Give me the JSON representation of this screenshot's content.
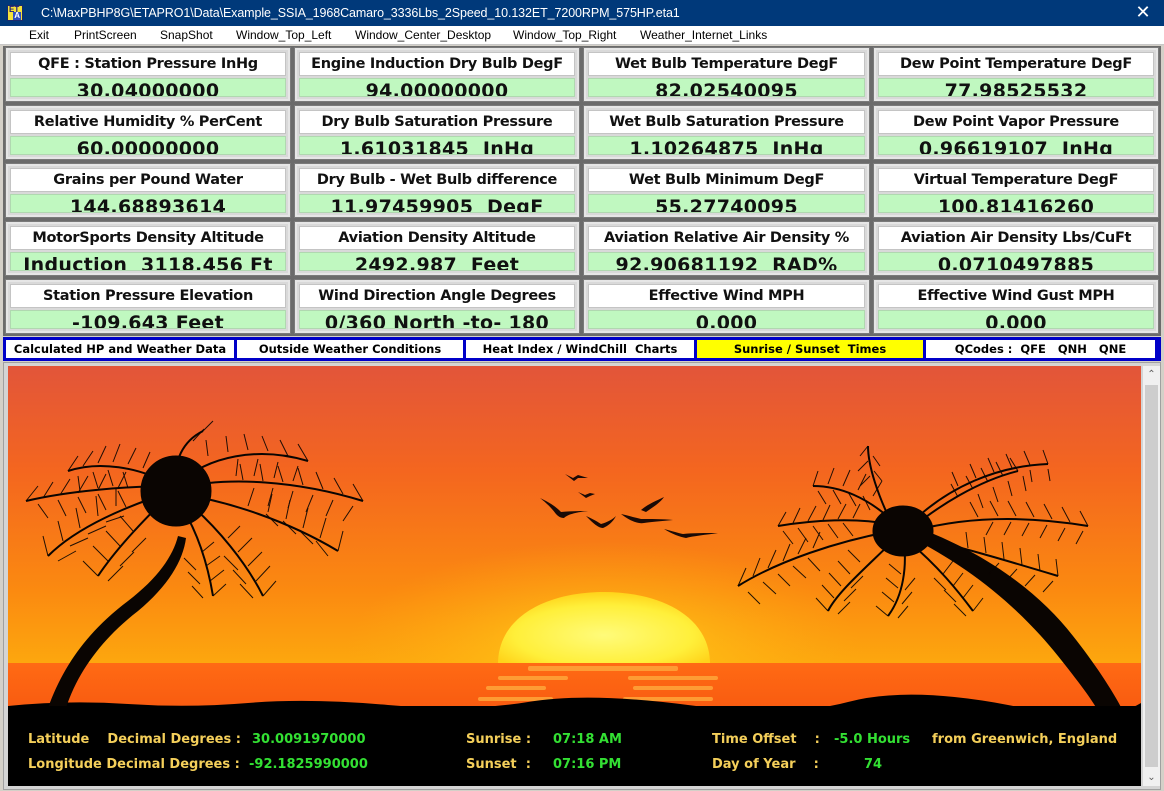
{
  "window": {
    "title": "C:\\MaxPBHP8G\\ETAPRO1\\Data\\Example_SSIA_1968Camaro_3336Lbs_2Speed_10.132ET_7200RPM_575HP.eta1",
    "app_icon_top": "ET",
    "app_icon_bottom": "A",
    "close_glyph": "✕"
  },
  "menu": [
    "Exit",
    "PrintScreen",
    "SnapShot",
    "Window_Top_Left",
    "Window_Center_Desktop",
    "Window_Top_Right",
    "Weather_Internet_Links"
  ],
  "cards": [
    {
      "label": "QFE :  Station Pressure InHg",
      "value": "30.04000000"
    },
    {
      "label": "Engine Induction Dry Bulb DegF",
      "value": "94.00000000"
    },
    {
      "label": "Wet Bulb Temperature DegF",
      "value": "82.02540095"
    },
    {
      "label": "Dew Point Temperature DegF",
      "value": "77.98525532"
    },
    {
      "label": "Relative Humidity % PerCent",
      "value": "60.00000000"
    },
    {
      "label": "Dry Bulb Saturation Pressure",
      "value": "1.61031845  InHg"
    },
    {
      "label": "Wet Bulb Saturation Pressure",
      "value": "1.10264875  InHg"
    },
    {
      "label": "Dew Point Vapor Pressure",
      "value": "0.96619107  InHg"
    },
    {
      "label": "Grains per Pound Water",
      "value": "144.68893614"
    },
    {
      "label": "Dry Bulb - Wet Bulb   difference",
      "value": "11.97459905  DegF"
    },
    {
      "label": "Wet Bulb  Minimum  DegF",
      "value": "55.27740095"
    },
    {
      "label": "Virtual Temperature DegF",
      "value": "100.81416260"
    },
    {
      "label": "MotorSports Density Altitude",
      "value": "Induction  3118.456 Ft"
    },
    {
      "label": "Aviation Density Altitude",
      "value": "2492.987  Feet"
    },
    {
      "label": "Aviation Relative Air Density %",
      "value": "92.90681192  RAD%"
    },
    {
      "label": "Aviation Air Density Lbs/CuFt",
      "value": "0.0710497885"
    },
    {
      "label": "Station Pressure Elevation",
      "value": "-109.643 Feet"
    },
    {
      "label": "Wind Direction Angle Degrees",
      "value": "0/360 North -to- 180"
    },
    {
      "label": "Effective Wind MPH",
      "value": "0.000"
    },
    {
      "label": "Effective Wind Gust MPH",
      "value": "0.000"
    }
  ],
  "tabs": [
    {
      "label": "Calculated HP and Weather Data",
      "active": false
    },
    {
      "label": "Outside Weather Conditions",
      "active": false
    },
    {
      "label": "Heat Index / WindChill  Charts",
      "active": false
    },
    {
      "label": "Sunrise / Sunset  Times",
      "active": true
    },
    {
      "label": "QCodes :  QFE   QNH   QNE",
      "active": false
    }
  ],
  "sun_info": {
    "latitude_label": "Latitude    Decimal Degrees :",
    "latitude_value": "30.0091970000",
    "longitude_label": "Longitude Decimal Degrees :",
    "longitude_value": "-92.1825990000",
    "sunrise_label": "Sunrise :",
    "sunrise_value": "07:18 AM",
    "sunset_label": "Sunset  :",
    "sunset_value": "07:16 PM",
    "time_offset_label": "Time Offset    :",
    "time_offset_value": "-5.0 Hours",
    "time_offset_suffix": "from Greenwich, England",
    "day_of_year_label": "Day of Year    :",
    "day_of_year_value": "74"
  },
  "scrollbar": {
    "up_glyph": "⌃",
    "down_glyph": "⌄"
  },
  "colors": {
    "titlebar": "#00397a",
    "value_bg": "#c0f8c0",
    "tab_active": "#ffff00",
    "tabbar": "#0000c8",
    "info_label": "#f4cf5a",
    "info_value": "#33e033"
  }
}
